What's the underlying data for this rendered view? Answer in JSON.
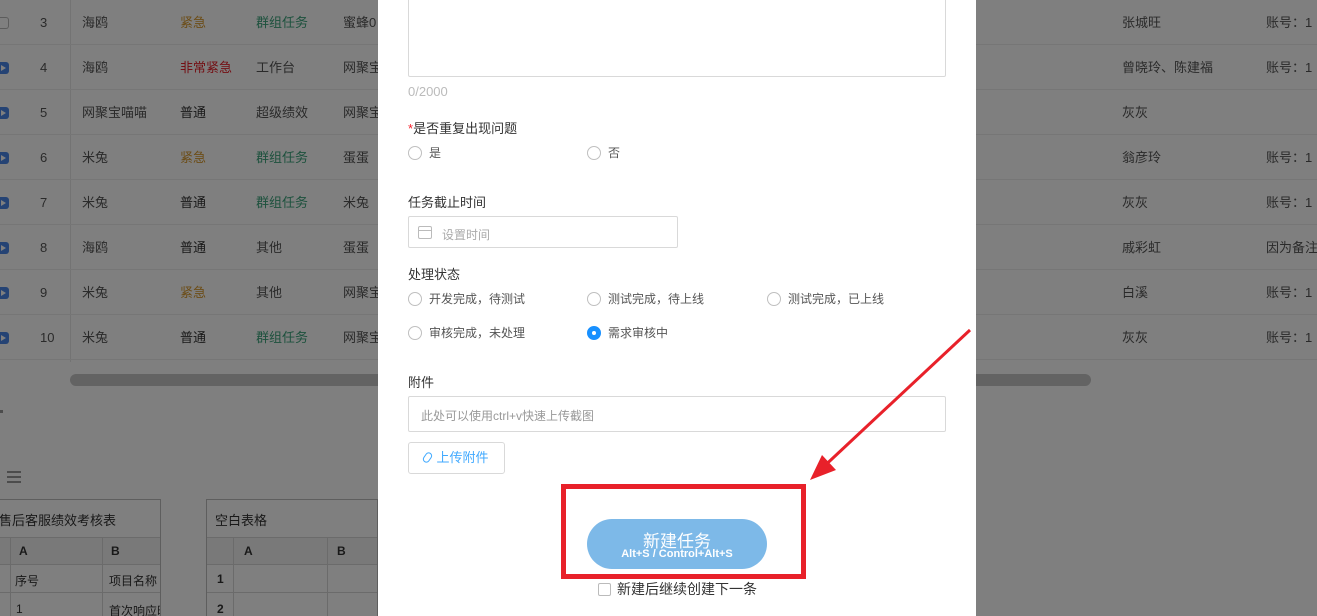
{
  "table": {
    "rows": [
      {
        "mark": "check",
        "num": "3",
        "name": "海鸥",
        "priority": "紧急",
        "priority_color": "#d89a2e",
        "type": "群组任务",
        "type_color": "#3aa37b",
        "creator": "蜜蜂0",
        "assignee": "张城旺",
        "remark": "账号：1"
      },
      {
        "mark": "play",
        "num": "4",
        "name": "海鸥",
        "priority": "非常紧急",
        "priority_color": "#e8212a",
        "type": "工作台",
        "type_color": "#555555",
        "creator": "网聚宝",
        "assignee": "曾晓玲、陈建福",
        "remark": "账号：1"
      },
      {
        "mark": "play",
        "num": "5",
        "name": "网聚宝喵喵",
        "priority": "普通",
        "priority_color": "#333333",
        "type": "超级绩效",
        "type_color": "#555555",
        "creator": "网聚宝",
        "assignee": "灰灰",
        "remark": ""
      },
      {
        "mark": "play",
        "num": "6",
        "name": "米兔",
        "priority": "紧急",
        "priority_color": "#d89a2e",
        "type": "群组任务",
        "type_color": "#3aa37b",
        "creator": "蛋蛋",
        "assignee": "翁彦玲",
        "remark": "账号：1"
      },
      {
        "mark": "play",
        "num": "7",
        "name": "米兔",
        "priority": "普通",
        "priority_color": "#333333",
        "type": "群组任务",
        "type_color": "#3aa37b",
        "creator": "米兔",
        "assignee": "灰灰",
        "remark": "账号：1"
      },
      {
        "mark": "play",
        "num": "8",
        "name": "海鸥",
        "priority": "普通",
        "priority_color": "#333333",
        "type": "其他",
        "type_color": "#555555",
        "creator": "蛋蛋",
        "assignee": "戚彩虹",
        "remark": "因为备注"
      },
      {
        "mark": "play",
        "num": "9",
        "name": "米兔",
        "priority": "紧急",
        "priority_color": "#d89a2e",
        "type": "其他",
        "type_color": "#555555",
        "creator": "网聚宝",
        "assignee": "白溪",
        "remark": "账号：1"
      },
      {
        "mark": "play",
        "num": "10",
        "name": "米兔",
        "priority": "普通",
        "priority_color": "#333333",
        "type": "群组任务",
        "type_color": "#3aa37b",
        "creator": "网聚宝",
        "assignee": "灰灰",
        "remark": "账号：1"
      }
    ]
  },
  "sheets": [
    {
      "title": "售后客服绩效考核表",
      "col_a": "A",
      "col_b": "B",
      "r1_a": "序号",
      "r1_b": "项目名称",
      "r2_a": "1",
      "r2_b": "首次响应时"
    },
    {
      "title": "空白表格",
      "col_a": "A",
      "col_b": "B",
      "r1_num": "1",
      "r2_num": "2"
    }
  ],
  "modal": {
    "char_count": "0/2000",
    "repeat_label": "是否重复出现问题",
    "required_mark": "*",
    "repeat_options": [
      "是",
      "否"
    ],
    "deadline_label": "任务截止时间",
    "deadline_placeholder": "设置时间",
    "status_label": "处理状态",
    "status_options": [
      "开发完成，待测试",
      "测试完成，待上线",
      "测试完成，已上线",
      "审核完成，未处理",
      "需求审核中"
    ],
    "status_selected": "需求审核中",
    "attach_label": "附件",
    "attach_placeholder": "此处可以使用ctrl+v快速上传截图",
    "upload_label": "上传附件",
    "create_label": "新建任务",
    "create_shortcut": "Alt+S / Control+Alt+S",
    "continue_label": "新建后继续创建下一条"
  },
  "colors": {
    "primary": "#1890ff",
    "create_button": "#7db9e8",
    "annotation_red": "#e8212a"
  }
}
